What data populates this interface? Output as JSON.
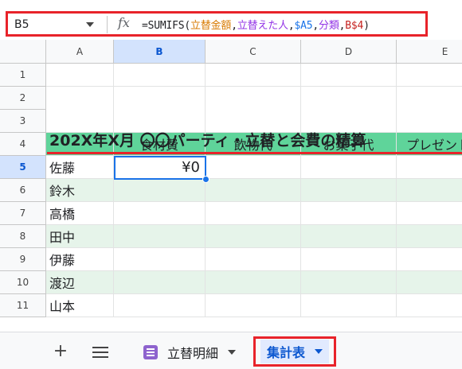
{
  "name_box": {
    "value": "B5"
  },
  "formula_bar": {
    "fx_label": "fx",
    "tokens": [
      {
        "text": "=SUMIFS(",
        "color": "plain"
      },
      {
        "text": "立替金額",
        "color": "orange"
      },
      {
        "text": ",",
        "color": "plain"
      },
      {
        "text": "立替えた人",
        "color": "purple"
      },
      {
        "text": ",",
        "color": "plain"
      },
      {
        "text": "$A5",
        "color": "blue"
      },
      {
        "text": ",",
        "color": "plain"
      },
      {
        "text": "分類",
        "color": "purple"
      },
      {
        "text": ",",
        "color": "plain"
      },
      {
        "text": "B$4",
        "color": "red"
      },
      {
        "text": ")",
        "color": "plain"
      }
    ]
  },
  "columns": [
    "A",
    "B",
    "C",
    "D",
    "E"
  ],
  "selected_column": "B",
  "rows": [
    "1",
    "2",
    "3",
    "4",
    "5",
    "6",
    "7",
    "8",
    "9",
    "10",
    "11"
  ],
  "selected_row": "5",
  "title": "202X年X月 〇〇パーティ・立替と会費の精算",
  "category_headers": [
    "食材費",
    "飲物代",
    "お菓子代",
    "プレゼント"
  ],
  "names": [
    "佐藤",
    "鈴木",
    "高橋",
    "田中",
    "伊藤",
    "渡辺",
    "山本"
  ],
  "active_cell_value": "¥0",
  "sheet_tabs": [
    {
      "label": "立替明細",
      "active": false
    },
    {
      "label": "集計表",
      "active": true
    }
  ],
  "colors": {
    "highlight_red": "#e8232a",
    "header_green": "#5fd49a",
    "band_light_green": "#e6f4ea",
    "selection_blue": "#1a73e8"
  }
}
